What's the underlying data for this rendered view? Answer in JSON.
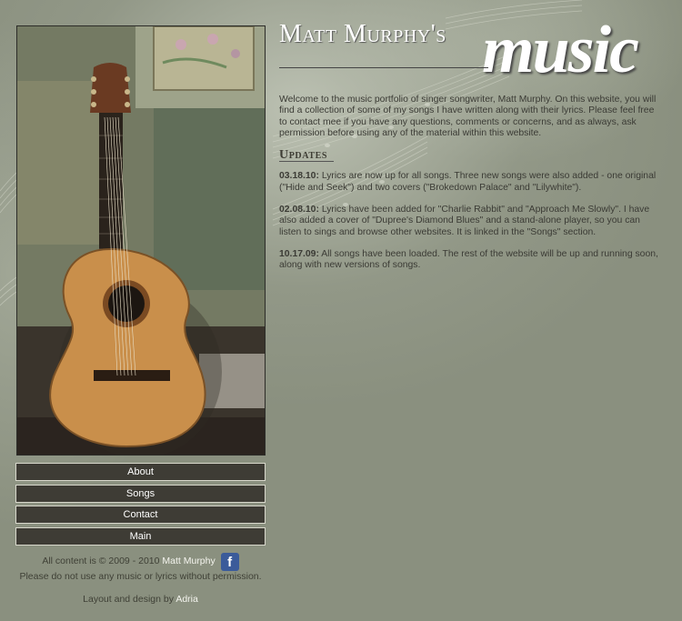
{
  "header": {
    "site_title": "Matt Murphy's",
    "site_title_word": "music"
  },
  "intro": "Welcome to the music portfolio of singer songwriter, Matt Murphy. On this website, you will find a collection of some of my songs I have written along with their lyrics. Please feel free to contact mee if you have any questions, comments or concerns, and as always, ask permission before using any of the material within this website.",
  "updates": {
    "heading": "Updates",
    "items": [
      {
        "date": "03.18.10:",
        "text": "Lyrics are now up for all songs. Three new songs were also added - one original (\"Hide and Seek\") and two covers (\"Brokedown Palace\" and \"Lilywhite\")."
      },
      {
        "date": "02.08.10:",
        "text": "Lyrics have been added for \"Charlie Rabbit\" and \"Approach Me Slowly\". I have also added a cover of \"Dupree's Diamond Blues\" and a stand-alone player, so you can listen to sings and browse other websites. It is linked in the \"Songs\" section."
      },
      {
        "date": "10.17.09:",
        "text": "All songs have been loaded. The rest of the website will be up and running soon, along with new versions of songs."
      }
    ]
  },
  "nav": {
    "items": [
      {
        "label": "About"
      },
      {
        "label": "Songs"
      },
      {
        "label": "Contact"
      },
      {
        "label": "Main"
      }
    ]
  },
  "footer": {
    "copyright_prefix": "All content is © 2009 - 2010",
    "author_link": "Matt Murphy",
    "facebook_icon_letter": "f",
    "notice": "Please do not use any music or lyrics without permission.",
    "design_prefix": "Layout and design by",
    "designer_link": "Adria"
  },
  "colors": {
    "background": "#8a907f",
    "nav_button": "#3e3c35",
    "link": "#f4f4ee"
  },
  "icons": [
    "facebook-icon",
    "guitar-photo"
  ]
}
